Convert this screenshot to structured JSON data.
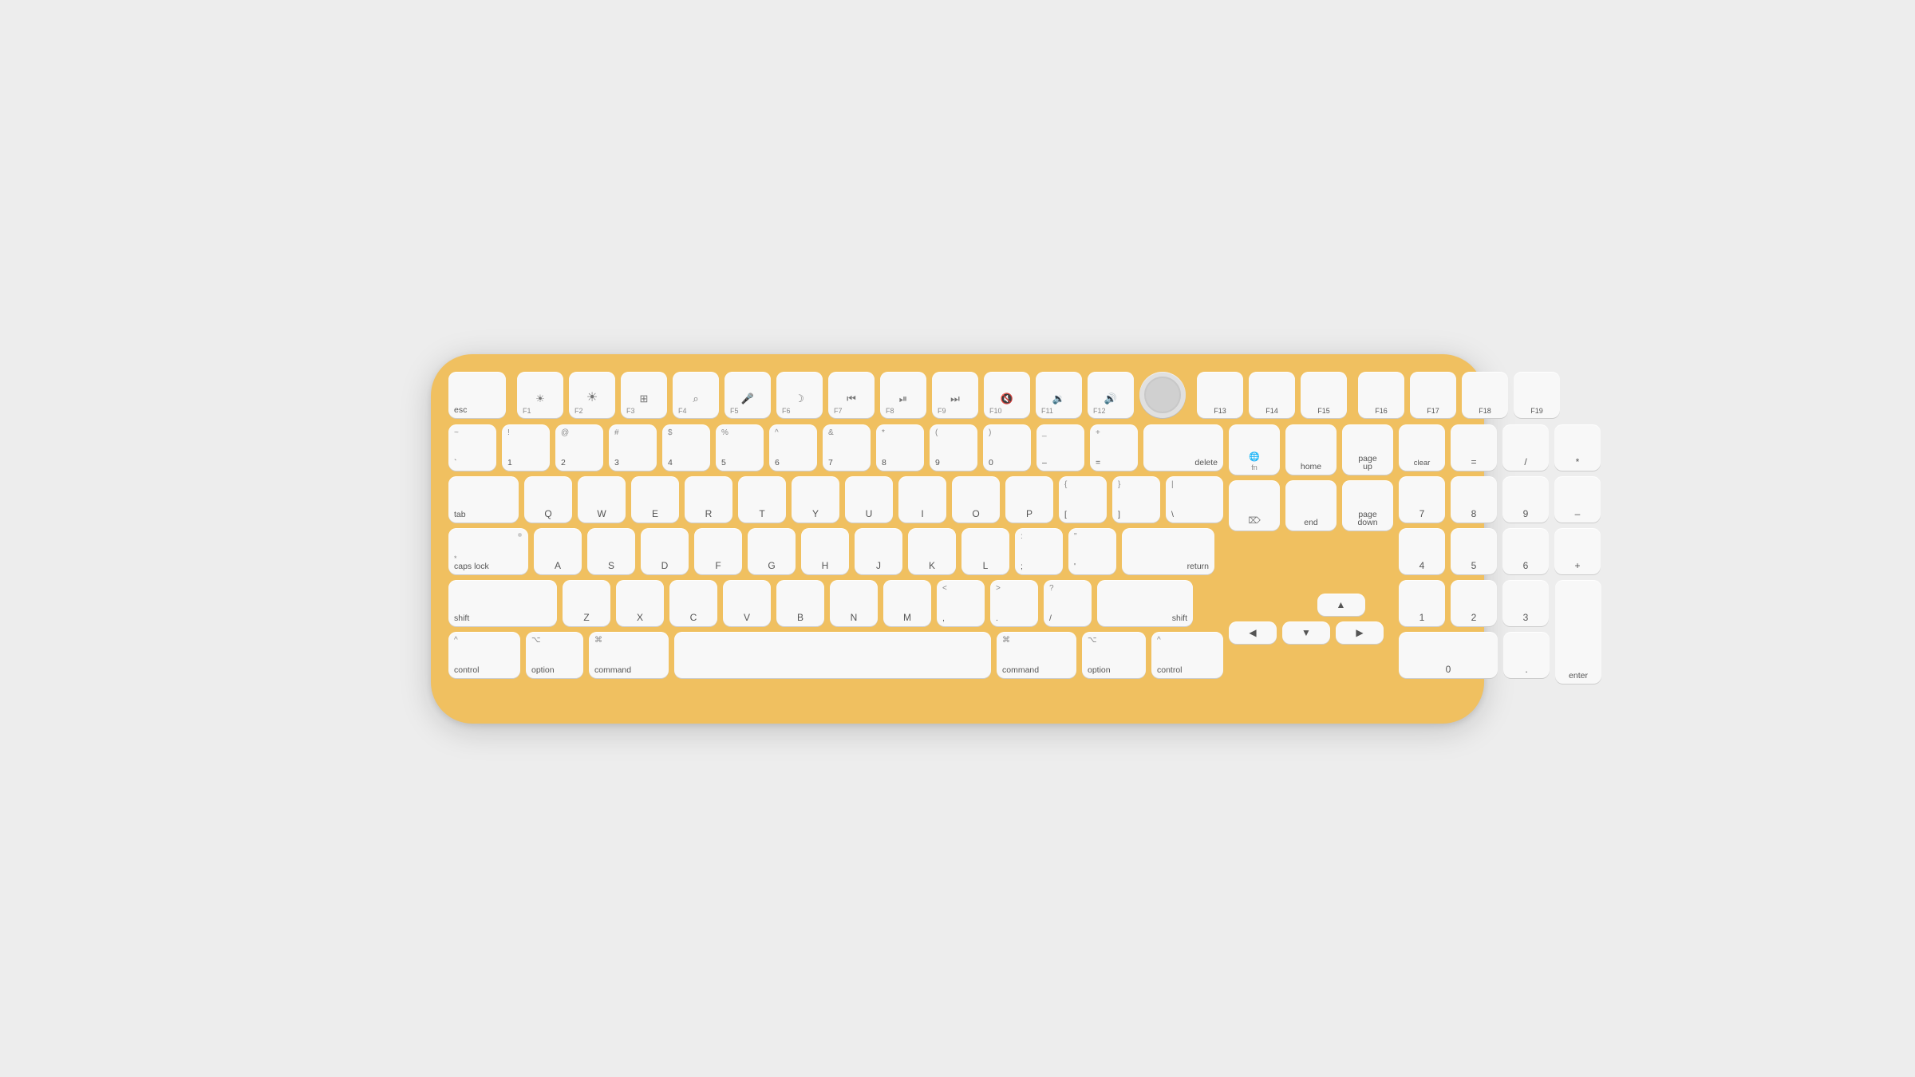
{
  "keyboard": {
    "color": "#F0C060",
    "rows": {
      "fn": [
        "esc",
        "F1",
        "F2",
        "F3",
        "F4",
        "F5",
        "F6",
        "F7",
        "F8",
        "F9",
        "F10",
        "F11",
        "F12",
        "touchid",
        "F13",
        "F14",
        "F15",
        "F16",
        "F17",
        "F18",
        "F19"
      ],
      "num": [
        "`",
        "1",
        "2",
        "3",
        "4",
        "5",
        "6",
        "7",
        "8",
        "9",
        "0",
        "-",
        "=",
        "delete"
      ],
      "q": [
        "tab",
        "Q",
        "W",
        "E",
        "R",
        "T",
        "Y",
        "U",
        "I",
        "O",
        "P",
        "[",
        "]",
        "\\"
      ],
      "a": [
        "caps lock",
        "A",
        "S",
        "D",
        "F",
        "G",
        "H",
        "J",
        "K",
        "L",
        ";",
        "'",
        "return"
      ],
      "z": [
        "shift",
        "Z",
        "X",
        "C",
        "V",
        "B",
        "N",
        "M",
        ",",
        ".",
        "/",
        "shift"
      ],
      "mod": [
        "control",
        "option",
        "command",
        "space",
        "command",
        "option",
        "control"
      ]
    }
  }
}
